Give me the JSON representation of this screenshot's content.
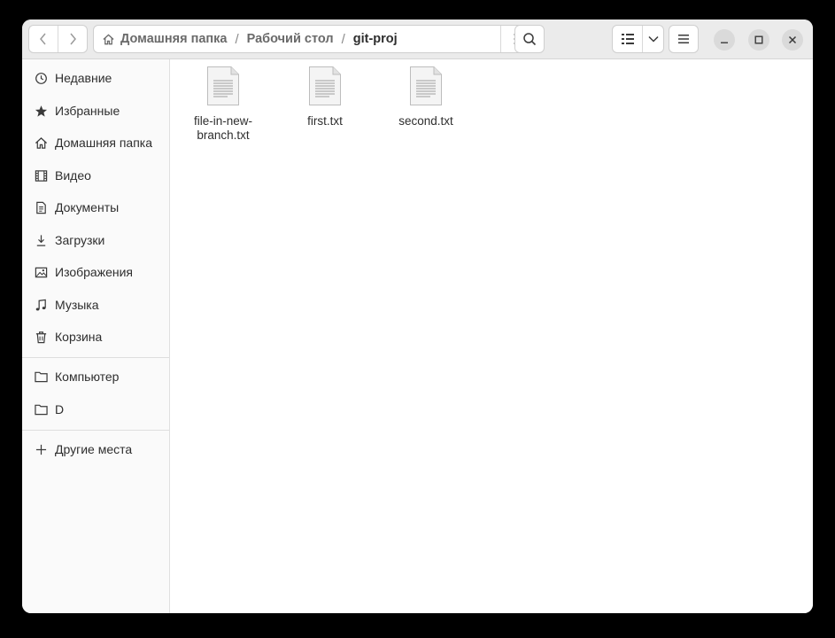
{
  "toolbar": {
    "path": [
      "Домашняя папка",
      "Рабочий стол",
      "git-proj"
    ]
  },
  "sidebar": {
    "places": [
      {
        "label": "Недавние",
        "icon": "clock-icon"
      },
      {
        "label": "Избранные",
        "icon": "star-icon"
      },
      {
        "label": "Домашняя папка",
        "icon": "home-icon"
      },
      {
        "label": "Видео",
        "icon": "video-icon"
      },
      {
        "label": "Документы",
        "icon": "document-icon"
      },
      {
        "label": "Загрузки",
        "icon": "download-icon"
      },
      {
        "label": "Изображения",
        "icon": "image-icon"
      },
      {
        "label": "Музыка",
        "icon": "music-icon"
      },
      {
        "label": "Корзина",
        "icon": "trash-icon"
      }
    ],
    "devices": [
      {
        "label": "Компьютер",
        "icon": "folder-icon"
      },
      {
        "label": "D",
        "icon": "folder-icon"
      }
    ],
    "other": {
      "label": "Другие места",
      "icon": "plus-icon"
    }
  },
  "files": [
    {
      "name": "file-in-new-branch.txt",
      "line1": "file-in-new-",
      "line2": "branch.txt"
    },
    {
      "name": "first.txt",
      "line1": "first.txt",
      "line2": ""
    },
    {
      "name": "second.txt",
      "line1": "second.txt",
      "line2": ""
    }
  ]
}
